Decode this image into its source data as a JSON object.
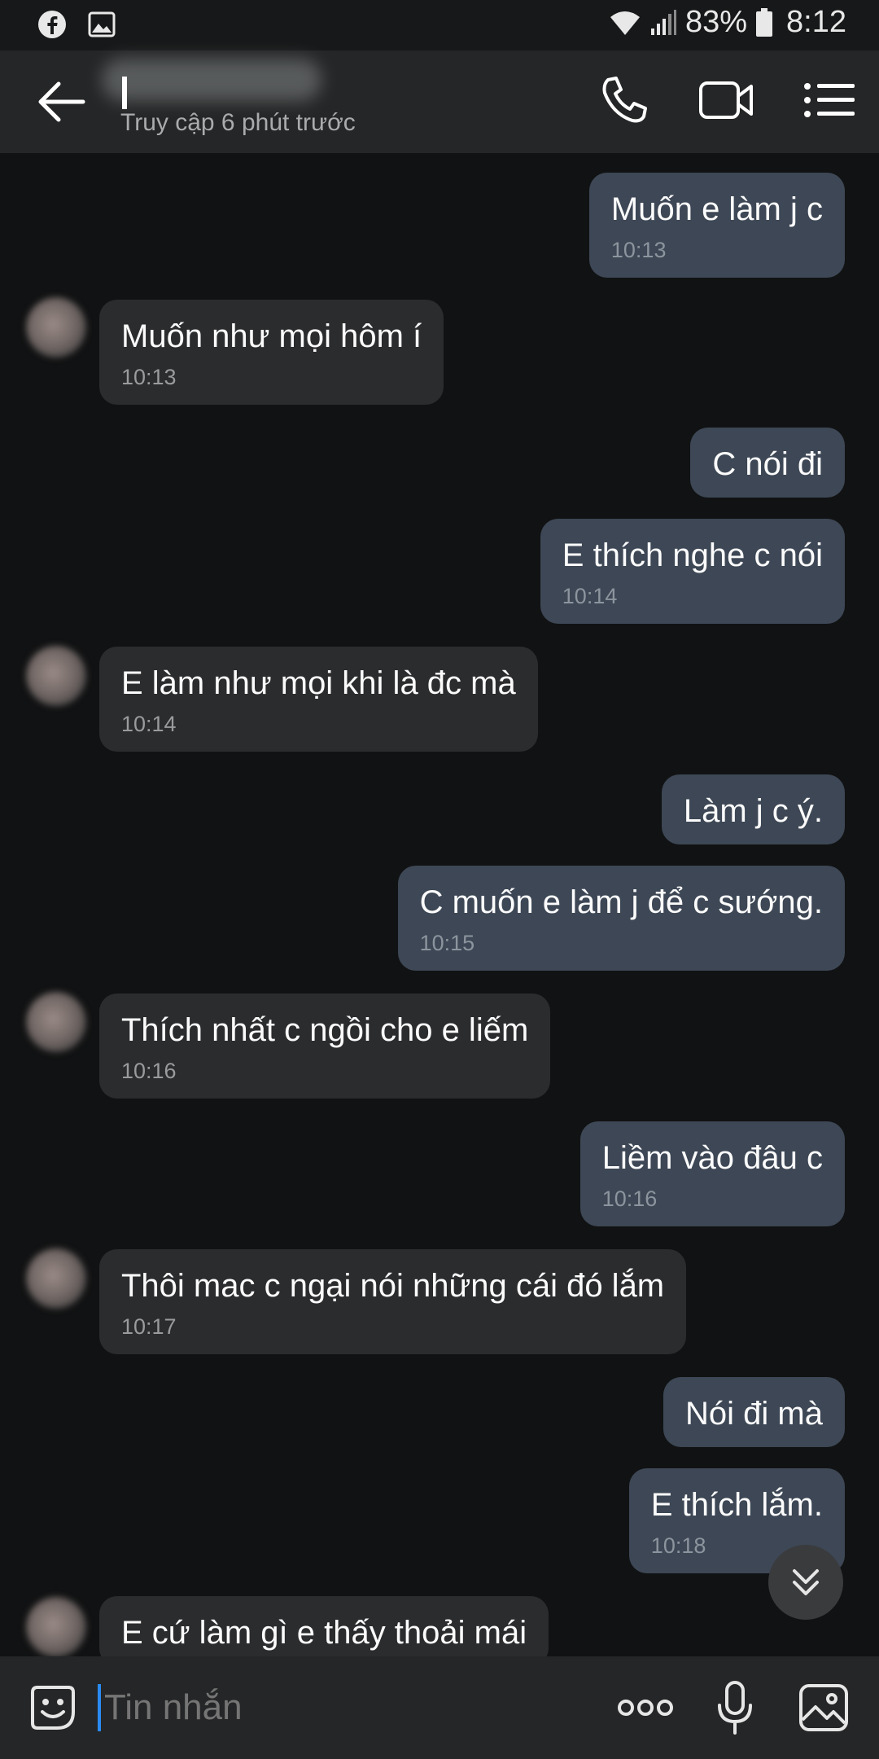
{
  "status_bar": {
    "battery": "83%",
    "time": "8:12"
  },
  "header": {
    "last_seen": "Truy cập 6 phút trước"
  },
  "messages": [
    {
      "dir": "out",
      "text": "Muốn e làm j c",
      "time": "10:13"
    },
    {
      "dir": "in",
      "text": "Muốn như mọi hôm í",
      "time": "10:13"
    },
    {
      "dir": "out",
      "text": "C nói đi",
      "time": ""
    },
    {
      "dir": "out",
      "text": "E thích nghe c nói",
      "time": "10:14"
    },
    {
      "dir": "in",
      "text": "E làm như mọi khi là đc mà",
      "time": "10:14"
    },
    {
      "dir": "out",
      "text": "Làm j c ý.",
      "time": ""
    },
    {
      "dir": "out",
      "text": "C muốn e làm j để c sướng.",
      "time": "10:15"
    },
    {
      "dir": "in",
      "text": "Thích nhất c ngồi cho e liếm",
      "time": "10:16"
    },
    {
      "dir": "out",
      "text": "Liềm vào đâu c",
      "time": "10:16"
    },
    {
      "dir": "in",
      "text": "Thôi mac c ngại nói những cái đó lắm",
      "time": "10:17"
    },
    {
      "dir": "out",
      "text": "Nói đi mà",
      "time": ""
    },
    {
      "dir": "out",
      "text": "E thích lắm.",
      "time": "10:18"
    },
    {
      "dir": "in",
      "text": "E cứ làm gì e thấy thoải mái",
      "time": ""
    }
  ],
  "input": {
    "placeholder": "Tin nhắn"
  },
  "icons": {
    "status": [
      "facebook-icon",
      "gallery-icon",
      "wifi-icon",
      "signal-icon",
      "battery-icon"
    ],
    "header": [
      "back-arrow-icon",
      "phone-icon",
      "video-call-icon",
      "menu-icon"
    ],
    "input": [
      "sticker-icon",
      "more-icon",
      "microphone-icon",
      "image-icon"
    ]
  },
  "colors": {
    "background": "#111213",
    "outgoing_bubble": "#3d4755",
    "incoming_bubble": "#2b2c2e",
    "header": "#252627",
    "caret": "#2a8bf2"
  }
}
